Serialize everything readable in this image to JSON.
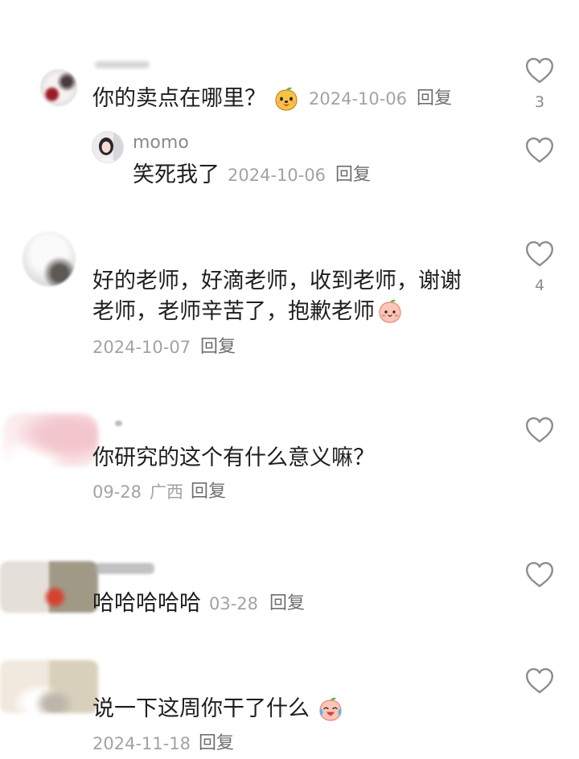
{
  "icons": {
    "like": "heart-outline-icon"
  },
  "comments": [
    {
      "text": "你的卖点在哪里？",
      "emoji": "dog-face-emoji",
      "date": "2024-10-06",
      "reply_label": "回复",
      "like_count": "3",
      "replies": [
        {
          "username": "momo",
          "text": "笑死我了",
          "date": "2024-10-06",
          "reply_label": "回复"
        }
      ]
    },
    {
      "text": "好的老师，好滴老师，收到老师，谢谢老师，老师辛苦了，抱歉老师",
      "emoji": "blush-face-emoji",
      "date": "2024-10-07",
      "reply_label": "回复",
      "like_count": "4"
    },
    {
      "text": "你研究的这个有什么意义嘛？",
      "date": "09-28",
      "location": "广西",
      "reply_label": "回复"
    },
    {
      "text": "哈哈哈哈哈",
      "date": "03-28",
      "reply_label": "回复"
    },
    {
      "text": "说一下这周你干了什么",
      "emoji": "laugh-cry-emoji",
      "date": "2024-11-18",
      "reply_label": "回复"
    }
  ],
  "colors": {
    "text": "#1e1e1e",
    "meta": "#a3a3a3",
    "reply": "#6f6f6f",
    "username": "#8a8a8a",
    "icon": "#8c8c8c",
    "background": "#ffffff"
  }
}
